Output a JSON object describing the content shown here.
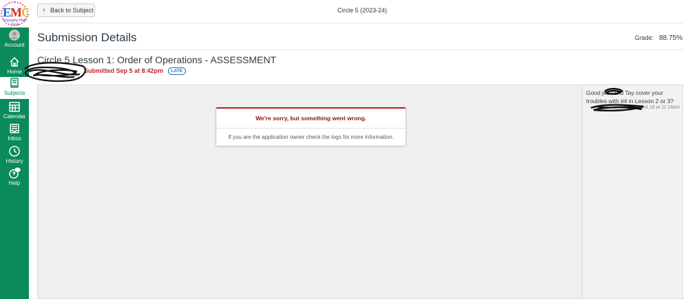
{
  "app": {
    "title": "Circle 5 (2023-24)",
    "logo_text": "EMC",
    "logo_sub": "Engaging Math Circle"
  },
  "nav": {
    "items": [
      {
        "label": "Account",
        "icon": "account-icon"
      },
      {
        "label": "Home",
        "icon": "home-icon"
      },
      {
        "label": "Subjects",
        "icon": "subjects-icon",
        "active": true
      },
      {
        "label": "Calendar",
        "icon": "calendar-icon"
      },
      {
        "label": "Inbox",
        "icon": "inbox-icon"
      },
      {
        "label": "History",
        "icon": "history-icon"
      },
      {
        "label": "Help",
        "icon": "help-icon"
      }
    ]
  },
  "header": {
    "back_label": "Back to Subject",
    "page_title": "Submission Details",
    "grade_label": "Grade:",
    "grade_value": "88.75%"
  },
  "assignment": {
    "title": "Circle 5 Lesson 1: Order of Operations - ASSESSMENT",
    "submitted": "Submitted Sep 5 at 8:42pm",
    "late_badge": "LATE"
  },
  "viewer": {
    "error_title": "We're sorry, but something went wrong.",
    "error_body": "If you are the application owner check the logs for more information."
  },
  "comments": [
    {
      "text": "Good job     ! Did Tay cover your troubles with #4 in Lesson 2 or 3?",
      "meta": "Oct 18 at 11:18am"
    }
  ],
  "colors": {
    "nav_bg": "#0b8a5c",
    "late_text": "#c0272d",
    "error_accent": "#b91d1d"
  }
}
